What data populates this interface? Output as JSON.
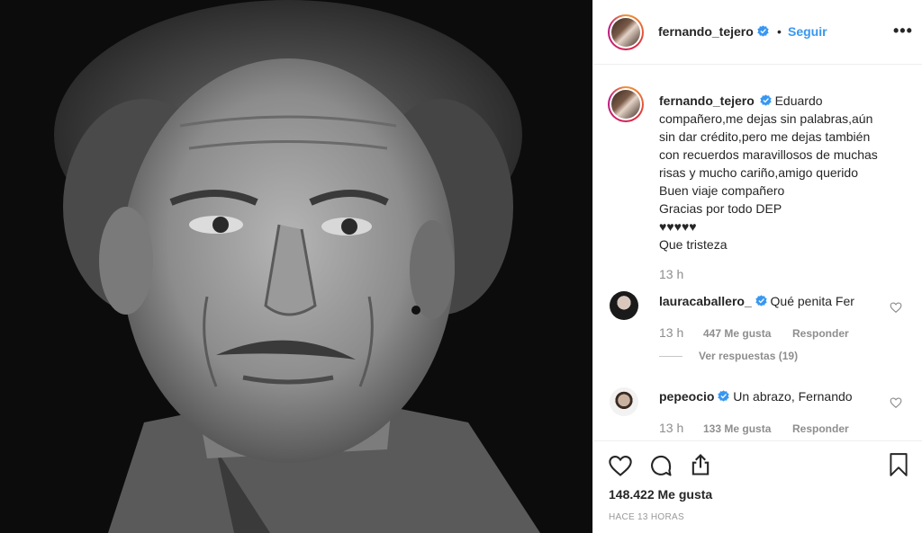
{
  "post": {
    "author": "fernando_tejero",
    "follow_label": "Seguir",
    "separator": "•",
    "more_label": "•••",
    "caption_lines": [
      "Eduardo",
      "compañero,me dejas sin palabras,aún",
      "sin dar crédito,pero me dejas también",
      "con recuerdos maravillosos de muchas",
      "risas y mucho cariño,amigo querido",
      "Buen viaje compañero",
      "Gracias por todo DEP",
      "♥♥♥♥♥",
      "Que tristeza"
    ],
    "caption_time": "13 h",
    "likes": "148.422 Me gusta",
    "posted_ago": "Hace 13 horas"
  },
  "comments": [
    {
      "user": "lauracaballero_",
      "text": "Qué penita Fer",
      "time": "13 h",
      "likes": "447 Me gusta",
      "reply_label": "Responder",
      "view_replies": "Ver respuestas (19)"
    },
    {
      "user": "pepeocio",
      "text": "Un abrazo, Fernando",
      "time": "13 h",
      "likes": "133 Me gusta",
      "reply_label": "Responder"
    }
  ],
  "icons": {
    "verified": "verified-badge-icon",
    "like": "heart-icon",
    "comment": "comment-icon",
    "share": "share-icon",
    "save": "bookmark-icon"
  },
  "colors": {
    "accent": "#3897f0",
    "text": "#262626",
    "muted": "#8e8e8e",
    "border": "#efefef"
  }
}
